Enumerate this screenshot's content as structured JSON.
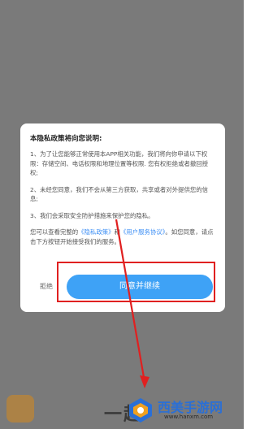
{
  "dialog": {
    "title": "本隐私政策将向您说明:",
    "para1": "1、为了让您能够正常使用本APP相关功能，我们将向你申请以下权限：存储空间、电话权限和地理位置等权限. 您有权拒绝或者撤回授权;",
    "para2": "2、未经您同意，我们不会从第三方获取，共享或者对外提供您的信息;",
    "para3": "3、我们会采取安全防护措施来保护您的隐私。",
    "para4_prefix": "您可以查看完整的",
    "privacy_link": "《隐私政策》",
    "para4_and": "和",
    "user_agreement_link": "《用户服务协议》",
    "para4_suffix": "。如您同意，请点击下方按钮开始接受我们的服务。",
    "decline_label": "拒绝",
    "agree_label": "同意并继续"
  },
  "background": {
    "title_fragment": "一起"
  },
  "watermark": {
    "text": "西美手游网",
    "url": "www.hanxm.com"
  },
  "colors": {
    "accent": "#3ea2f6",
    "highlight": "#e02020",
    "overlay": "#7a7a7a"
  }
}
